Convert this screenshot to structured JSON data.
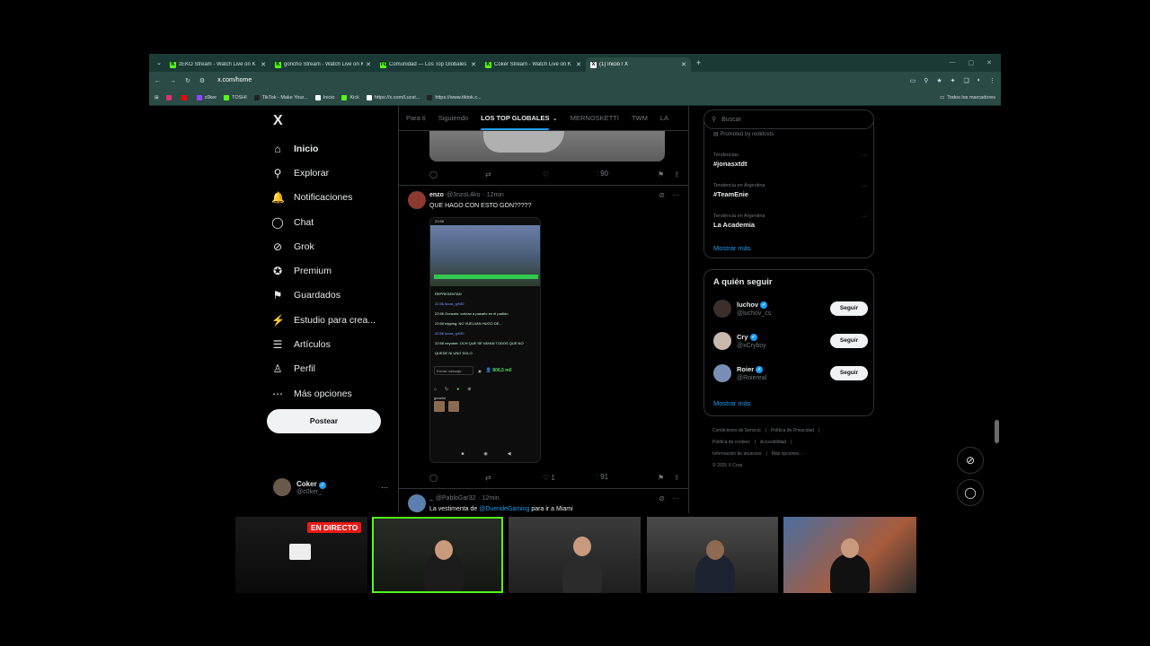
{
  "browser": {
    "tabs": [
      {
        "title": "zEKO Stream - Watch Live on K",
        "favicon": "K",
        "color": "#53fc18"
      },
      {
        "title": "goncho Stream - Watch Live on K",
        "favicon": "K",
        "color": "#53fc18"
      },
      {
        "title": "Comunidad — Los Top Globales",
        "favicon": "TG",
        "color": "#53fc18"
      },
      {
        "title": "Coker Stream - Watch Live on K",
        "favicon": "K",
        "color": "#53fc18"
      },
      {
        "title": "(1) Inicio / X",
        "favicon": "X",
        "color": "#ffffff"
      }
    ],
    "url": "x.com/home",
    "bookmarks": [
      {
        "label": "",
        "color": "#e1306c"
      },
      {
        "label": "",
        "color": "#ff0000"
      },
      {
        "label": "c0ker",
        "color": "#9146ff"
      },
      {
        "label": "TOSHI",
        "color": "#53fc18"
      },
      {
        "label": "TikTok - Make Your...",
        "color": "#222"
      },
      {
        "label": "Inicio",
        "color": "#ffffff"
      },
      {
        "label": "Kick",
        "color": "#53fc18"
      },
      {
        "label": "https://x.com/Lucst...",
        "color": "#ffffff"
      },
      {
        "label": "https://www.tiktok.c...",
        "color": "#222"
      }
    ],
    "all_bookmarks": "Todos los marcadores"
  },
  "sidebar": {
    "logo": "X",
    "items": [
      {
        "label": "Inicio",
        "icon": "home-icon",
        "glyph": "⌂"
      },
      {
        "label": "Explorar",
        "icon": "search-icon",
        "glyph": "⚲"
      },
      {
        "label": "Notificaciones",
        "icon": "bell-icon",
        "glyph": "🔔"
      },
      {
        "label": "Chat",
        "icon": "chat-icon",
        "glyph": "◯"
      },
      {
        "label": "Grok",
        "icon": "grok-icon",
        "glyph": "⊘"
      },
      {
        "label": "Premium",
        "icon": "premium-icon",
        "glyph": "✪"
      },
      {
        "label": "Guardados",
        "icon": "bookmark-icon",
        "glyph": "⚑"
      },
      {
        "label": "Estudio para crea...",
        "icon": "studio-icon",
        "glyph": "⚡"
      },
      {
        "label": "Artículos",
        "icon": "articles-icon",
        "glyph": "☰"
      },
      {
        "label": "Perfil",
        "icon": "profile-icon",
        "glyph": "♙"
      },
      {
        "label": "Más opciones",
        "icon": "more-icon",
        "glyph": "⋯"
      }
    ],
    "post_button": "Postear",
    "account": {
      "name": "Coker",
      "handle": "@c0ker_"
    }
  },
  "feed": {
    "tabs": [
      "Para ti",
      "Siguiendo",
      "LOS TOP GLOBALES",
      "MERNOSKETTI",
      "TWM",
      "LA"
    ],
    "active_tab": "LOS TOP GLOBALES",
    "first_post_views": "90",
    "tweet": {
      "name": "enzo",
      "handle": "@3nzoL4ko",
      "time": "· 12min",
      "text": "QUE HAGO CON ESTO GON?????",
      "likes": "1",
      "views": "91",
      "phone": {
        "time": "23:56",
        "chat": [
          {
            "text": "REPRESENTAN",
            "kind": "t"
          },
          {
            "text": "22:56 lucas_ty930",
            "kind": "u"
          },
          {
            "text": "22:56 Gonzalo: volvían a pasarlo en el partido",
            "kind": "t"
          },
          {
            "text": "22:56 tripping: NO VUELVAN HUGO DE...",
            "kind": "t"
          },
          {
            "text": "22:56 lucas_ty930",
            "kind": "u"
          },
          {
            "text": "22:56 neyobet: OCH QUE SE VAYAN TODOS QUE NO",
            "kind": "t"
          },
          {
            "text": "QUEDE NI UNO SOLO",
            "kind": "t"
          }
        ],
        "input_placeholder": "Enviar mensaje",
        "viewers": "806,5 mil",
        "streamer": "goncho"
      }
    },
    "next_tweet": {
      "name": "_",
      "handle": "@PabloGar32",
      "time": "· 12min",
      "text_pre": "La vestimenta de",
      "mention": "@DuendeGaming",
      "text_post": "para ir a Miami"
    }
  },
  "right": {
    "search_placeholder": "Buscar",
    "promoted": "Promoted by redidosts",
    "trends": [
      {
        "context": "Tendencias",
        "title": "#jonasxtdt"
      },
      {
        "context": "Tendencia en Argentina",
        "title": "#TeamEnie"
      },
      {
        "context": "Tendencia en Argentina",
        "title": "La Academia"
      }
    ],
    "show_more": "Mostrar más",
    "who_to_follow": {
      "title": "A quién seguir",
      "users": [
        {
          "name": "luchov",
          "handle": "@luchov_cs",
          "button": "Seguir",
          "color": "#3a2f2a"
        },
        {
          "name": "Cry",
          "handle": "@xCryboy",
          "button": "Seguir",
          "color": "#c9b8ae"
        },
        {
          "name": "Roier",
          "handle": "@Roiereal",
          "button": "Seguir",
          "color": "#7a8fb5"
        }
      ],
      "show_more": "Mostrar más"
    },
    "footer": [
      "Condiciones de Servicio",
      "|",
      "Política de Privacidad",
      "|",
      "Política de cookies",
      "|",
      "Accesibilidad",
      "|",
      "Información de anuncios",
      "|",
      "Más opciones ···",
      "© 2025 X Corp."
    ]
  },
  "stream_overlay": {
    "live_label": "EN DIRECTO"
  }
}
